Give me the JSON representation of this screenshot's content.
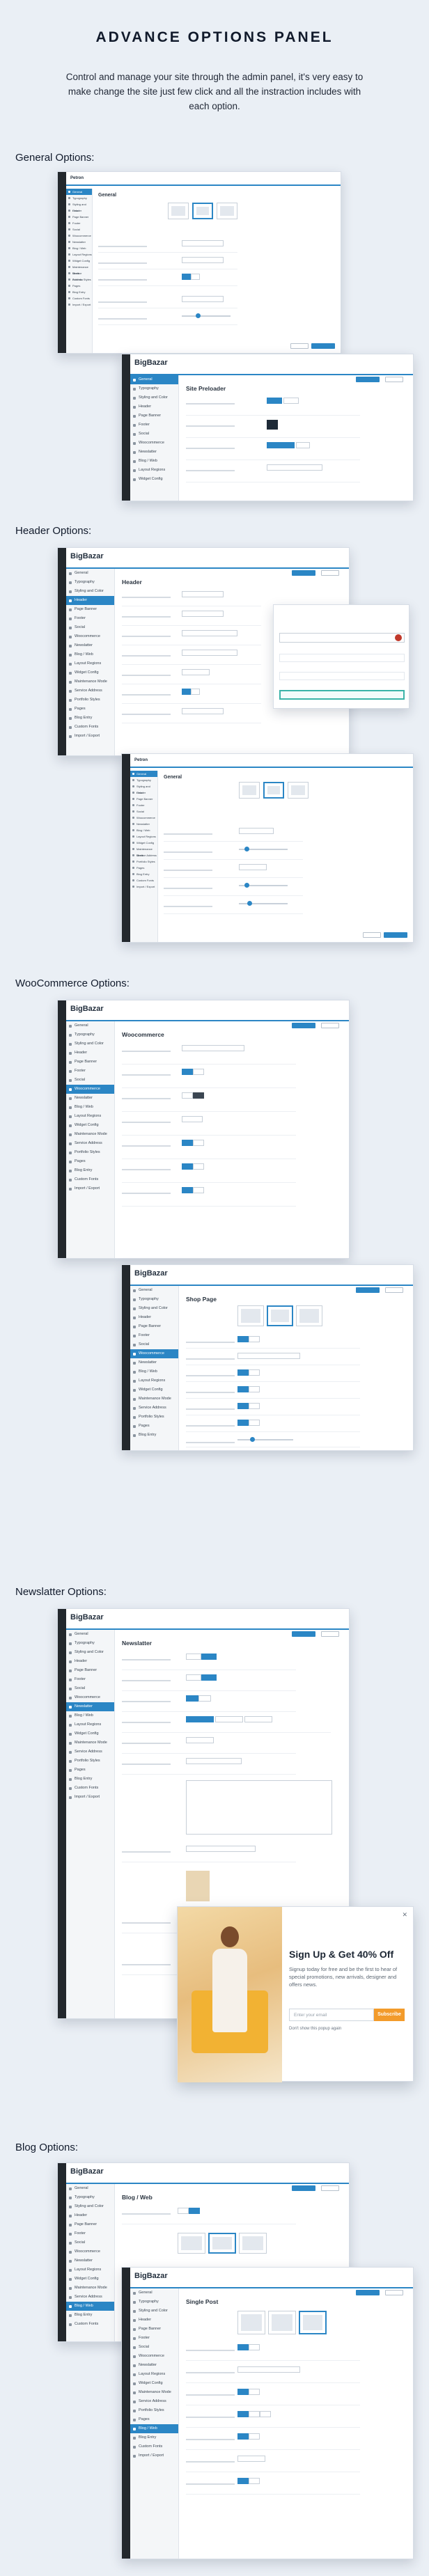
{
  "header": {
    "title": "ADVANCE OPTIONS PANEL",
    "description": "Control and manage your site through the admin panel, it's very easy to make change the site just few click and all the instraction includes with each option."
  },
  "sections": [
    {
      "label": "General Options:"
    },
    {
      "label": "Header Options:"
    },
    {
      "label": "WooCommerce Options:"
    },
    {
      "label": "Newslatter Options:"
    },
    {
      "label": "Blog Options:"
    }
  ],
  "brand": "BigBazar",
  "windows": {
    "general_back": {
      "brand": "Petron",
      "panel_title": "General"
    },
    "general_front": {
      "brand": "BigBazar",
      "panel_title": "Site Preloader"
    },
    "header_back": {
      "brand": "BigBazar",
      "panel_title": "Header"
    },
    "header_front": {
      "brand": "Petron",
      "panel_title": "General"
    },
    "woo_back": {
      "brand": "BigBazar",
      "panel_title": "Woocommerce"
    },
    "woo_front": {
      "brand": "BigBazar",
      "panel_title": "Shop Page"
    },
    "news": {
      "brand": "BigBazar",
      "panel_title": "Newslatter"
    },
    "blog_back": {
      "brand": "BigBazar",
      "panel_title": "Blog / Web"
    },
    "blog_front": {
      "brand": "BigBazar",
      "panel_title": "Single Post"
    }
  },
  "sidebar_items": [
    "General",
    "Typography",
    "Styling and Color",
    "Header",
    "Page Banner",
    "Footer",
    "Social",
    "Woocommerce",
    "Newslatter",
    "Blog / Web",
    "Layout Regions",
    "Widget Config",
    "Maintenance Mode",
    "Service Address",
    "Portfolio Styles",
    "Pages",
    "Blog Entry",
    "Custom Fonts",
    "Import / Export"
  ],
  "newsletter_popup": {
    "title": "Sign Up & Get 40% Off",
    "text": "Signup today for free and be the first to hear of special promotions, new arrivals, designer and offers news.",
    "email_placeholder": "Enter your email",
    "button": "Subscribe",
    "checkbox": "Don't show this popup again"
  },
  "colors": {
    "accent": "#2b86c5",
    "popup_button": "#f39b2b"
  }
}
